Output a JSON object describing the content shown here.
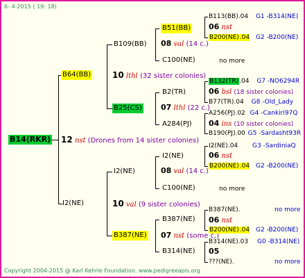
{
  "header": "6- 4-2015 ( 19: 18)",
  "copyright": "Copyright 2004-2015 @ Karl Kehrle Foundation.   www.pedigreeapis.org",
  "root": "B14(RKR)",
  "root_num": "12",
  "root_tag": "nst",
  "root_text": "(Drones from 14 sister colonies)",
  "l1_top": {
    "name": "B64(BB)",
    "num": "10",
    "tag": "lthl",
    "text": "(32 sister colonies)"
  },
  "l1_bot": {
    "name": "I2(NE)",
    "num": "10",
    "tag": "val",
    "text": "(9 sister colonies)"
  },
  "l2": {
    "b109": {
      "name": "B109(BB)",
      "num": "08",
      "tag": "val",
      "text": "(14 c.)"
    },
    "b25": {
      "name": "B25(CS)",
      "num": "07",
      "tag": "lthl",
      "text": "(22 c.)"
    },
    "i2": {
      "name": "I2(NE)",
      "num": "08",
      "tag": "val",
      "text": "(14 c.)"
    },
    "b387": {
      "name": "B387(NE)",
      "num": "07",
      "tag": "nst",
      "text": "(some c.)"
    }
  },
  "l3": {
    "b51": "B51(BB)",
    "c100a": "C100(NE)",
    "b2": "B2(TR)",
    "a284": "A284(PJ)",
    "i2b": "I2(NE)",
    "c100b": "C100(NE)",
    "b387b": "B387(NE)",
    "b314": "B314(NE)"
  },
  "l4": [
    {
      "name": "B113(BB)",
      "year": ".04",
      "code": "G1 -B314(NE)"
    },
    {
      "num": "06",
      "tag": "nst"
    },
    {
      "name": "B200(NE)",
      "year": ".04",
      "code": "G2 -B200(NE)"
    },
    {
      "name": "no more"
    },
    {
      "name": "B132(TR)",
      "year": ".04",
      "code": "G7 -NO6294R"
    },
    {
      "num": "06",
      "tag": "bsl",
      "text": "(18 sister colonies)"
    },
    {
      "name": "B77(TR)",
      "year": ".04",
      "code": "G8 -Old_Lady"
    },
    {
      "name": "A256(PJ)",
      "year": ".02",
      "code": "G4 -Cankiri97Q"
    },
    {
      "num": "04",
      "tag": "ins",
      "text": "(10 sister colonies)"
    },
    {
      "name": "B190(PJ)",
      "year": ".00",
      "code": "G5 -Sardasht93R"
    },
    {
      "name": "I2(NE)",
      "year": ".04",
      "code": "G3 -SardiniaQ"
    },
    {
      "num": "06",
      "tag": "nst"
    },
    {
      "name": "B200(NE)",
      "year": ".04",
      "code": "G2 -B200(NE)"
    },
    {
      "name": "no more"
    },
    {
      "name": "B387(NE)",
      "year": ".",
      "code": "no more"
    },
    {
      "num": "06",
      "tag": "nst"
    },
    {
      "name": "B200(NE)",
      "year": ".04",
      "code": "G2 -B200(NE)"
    },
    {
      "name": "B314(NE)",
      "year": ".03",
      "code": "G0 -B314(NE)"
    },
    {
      "num": "05"
    },
    {
      "name": "???(NE)",
      "year": ".",
      "code": "no more"
    }
  ]
}
